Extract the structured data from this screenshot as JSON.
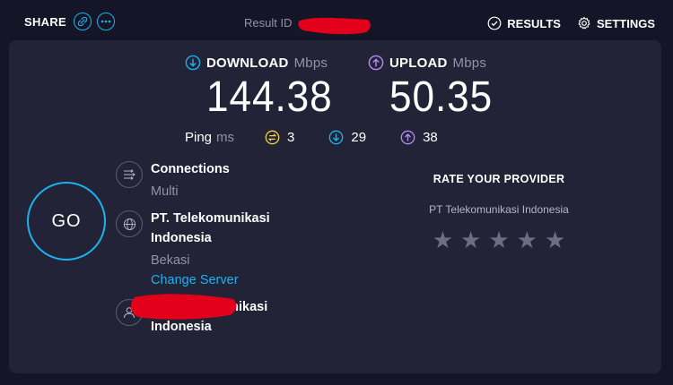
{
  "header": {
    "share_label": "SHARE",
    "result_id_label": "Result ID",
    "results_label": "RESULTS",
    "settings_label": "SETTINGS"
  },
  "download": {
    "label": "DOWNLOAD",
    "unit": "Mbps",
    "value": "144.38"
  },
  "upload": {
    "label": "UPLOAD",
    "unit": "Mbps",
    "value": "50.35"
  },
  "ping": {
    "label": "Ping",
    "unit": "ms",
    "idle": "3",
    "download": "29",
    "upload": "38"
  },
  "go_label": "GO",
  "connections": {
    "title": "Connections",
    "value": "Multi"
  },
  "server": {
    "name_line1": "PT. Telekomunikasi",
    "name_line2": "Indonesia",
    "location": "Bekasi",
    "change_label": "Change Server"
  },
  "isp": {
    "name_line1": "PT Telekomunikasi",
    "name_line2": "Indonesia"
  },
  "rate": {
    "title": "RATE YOUR PROVIDER",
    "provider": "PT Telekomunikasi Indonesia",
    "stars": 5
  },
  "colors": {
    "accent": "#1ab3f0",
    "download": "#1ab3f0",
    "upload": "#b78cf0",
    "ping": "#f3d34a",
    "redaction": "#e3001b"
  }
}
